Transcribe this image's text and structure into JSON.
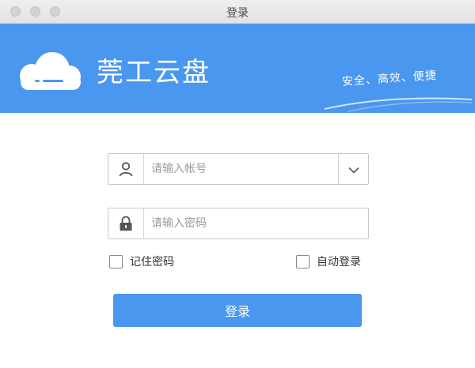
{
  "window": {
    "title": "登录"
  },
  "banner": {
    "app_name": "莞工云盘",
    "slogan": "安全、高效、便捷",
    "color": "#4a97ef"
  },
  "form": {
    "username": {
      "value": "",
      "placeholder": "请输入帐号",
      "icon": "user-icon",
      "dropdown_icon": "chevron-down-icon"
    },
    "password": {
      "value": "",
      "placeholder": "请输入密码",
      "icon": "lock-icon"
    },
    "remember_password": {
      "label": "记住密码",
      "checked": false
    },
    "auto_login": {
      "label": "自动登录",
      "checked": false
    },
    "login_button": {
      "label": "登录"
    }
  }
}
